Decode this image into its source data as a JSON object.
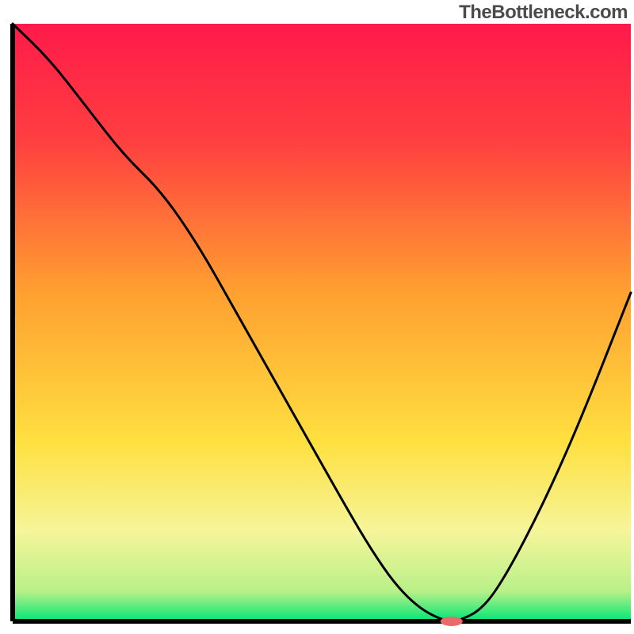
{
  "watermark": "TheBottleneck.com",
  "chart_data": {
    "type": "line",
    "title": "",
    "xlabel": "",
    "ylabel": "",
    "xlim": [
      0,
      100
    ],
    "ylim": [
      0,
      100
    ],
    "background_gradient": {
      "stops": [
        {
          "offset": 0.0,
          "color": "#ff1a4a"
        },
        {
          "offset": 0.2,
          "color": "#ff4040"
        },
        {
          "offset": 0.45,
          "color": "#ffa030"
        },
        {
          "offset": 0.7,
          "color": "#ffe040"
        },
        {
          "offset": 0.85,
          "color": "#f5f59a"
        },
        {
          "offset": 0.95,
          "color": "#b8f088"
        },
        {
          "offset": 1.0,
          "color": "#00e676"
        }
      ]
    },
    "series": [
      {
        "name": "bottleneck-curve",
        "color": "#000000",
        "width": 3,
        "x": [
          0,
          6,
          12,
          18,
          24,
          30,
          36,
          42,
          48,
          54,
          58,
          62,
          66,
          70,
          72,
          76,
          80,
          86,
          92,
          100
        ],
        "y": [
          100,
          94,
          86,
          78,
          72,
          63,
          52,
          41,
          30,
          19,
          12,
          6,
          2,
          0,
          0,
          2,
          8,
          20,
          34,
          55
        ]
      }
    ],
    "marker": {
      "name": "target-marker",
      "x": 71,
      "y": 0,
      "color": "#e86a6a",
      "rx": 14,
      "ry": 6
    },
    "axes": {
      "color": "#000000",
      "width": 6
    }
  }
}
